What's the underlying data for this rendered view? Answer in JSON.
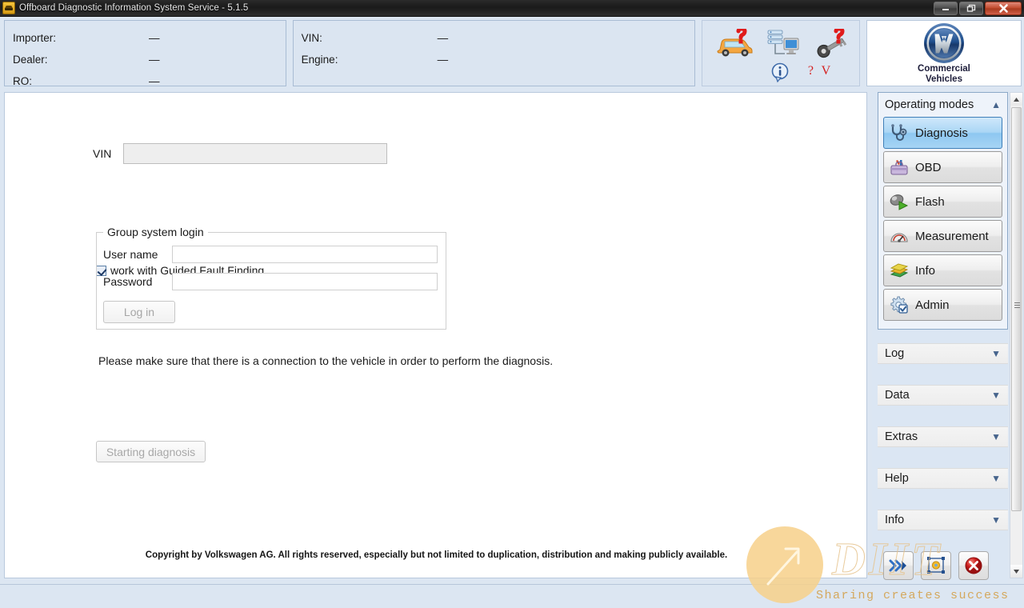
{
  "window": {
    "title": "Offboard Diagnostic Information System Service - 5.1.5",
    "app_icon": "car-icon",
    "minimize_label": "–",
    "maximize_label": "❐",
    "close_label": "✕"
  },
  "header": {
    "owner": [
      {
        "key": "Importer:",
        "value": "—"
      },
      {
        "key": "Dealer:",
        "value": "—"
      },
      {
        "key": "RO:",
        "value": "—"
      }
    ],
    "vehicle": [
      {
        "key": "VIN:",
        "value": "—"
      },
      {
        "key": "Engine:",
        "value": "—"
      }
    ],
    "icons": [
      {
        "name": "vehicle-identification-icon",
        "title": "Vehicle identification"
      },
      {
        "name": "network-connection-icon",
        "title": "Network connection"
      },
      {
        "name": "key-unknown-icon",
        "title": "Key"
      },
      {
        "name": "info-icon",
        "title": "Information"
      }
    ],
    "qv_label": "? V",
    "logo": {
      "mark": "vw-logo",
      "line1": "Commercial",
      "line2": "Vehicles"
    }
  },
  "main": {
    "vin": {
      "label": "VIN",
      "value": "",
      "placeholder": "",
      "disabled": true
    },
    "guided_fault_finding": {
      "label": "work with Guided Fault Finding",
      "checked": true
    },
    "login_group": {
      "legend": "Group system login",
      "username_label": "User name",
      "username_value": "",
      "password_label": "Password",
      "password_value": "",
      "login_button": "Log in"
    },
    "hint": "Please make sure that there is a connection to the vehicle in order to perform the diagnosis.",
    "start_button": "Starting diagnosis",
    "copyright": "Copyright by Volkswagen AG. All rights reserved, especially but not limited to duplication, distribution and making publicly available."
  },
  "sidebar": {
    "operating_modes": {
      "title": "Operating modes",
      "collapse_icon": "chevron-up-icon",
      "items": [
        {
          "label": "Diagnosis",
          "icon": "stethoscope-icon",
          "selected": true
        },
        {
          "label": "OBD",
          "icon": "toolbox-icon",
          "selected": false
        },
        {
          "label": "Flash",
          "icon": "flash-play-icon",
          "selected": false
        },
        {
          "label": "Measurement",
          "icon": "gauge-icon",
          "selected": false
        },
        {
          "label": "Info",
          "icon": "books-icon",
          "selected": false
        },
        {
          "label": "Admin",
          "icon": "gear-check-icon",
          "selected": false
        }
      ]
    },
    "sections": [
      {
        "label": "Log",
        "icon": "chevron-down-icon"
      },
      {
        "label": "Data",
        "icon": "chevron-down-icon"
      },
      {
        "label": "Extras",
        "icon": "chevron-down-icon"
      },
      {
        "label": "Help",
        "icon": "chevron-down-icon"
      },
      {
        "label": "Info",
        "icon": "chevron-down-icon"
      }
    ],
    "actions": [
      {
        "name": "next-button",
        "icon": "double-chevron-right-icon"
      },
      {
        "name": "screenshot-button",
        "icon": "capture-frame-icon"
      },
      {
        "name": "cancel-button",
        "icon": "red-x-circle-icon"
      }
    ]
  },
  "scrollbar": {
    "up_icon": "triangle-up-icon",
    "down_icon": "triangle-down-icon"
  },
  "watermark": {
    "mark": "arrow-circle-logo",
    "big_text": "DIIT",
    "tagline": "Sharing creates success"
  },
  "colors": {
    "accent": "#8ec7f1",
    "header_bg": "#dce6f2",
    "panel_bg": "#dbe5f1",
    "danger": "#d42020"
  }
}
